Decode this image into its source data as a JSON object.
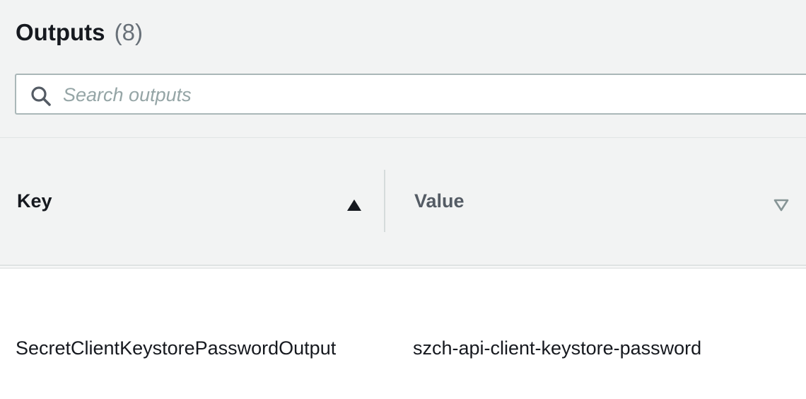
{
  "outputs": {
    "title": "Outputs",
    "count": "(8)",
    "search": {
      "placeholder": "Search outputs",
      "value": ""
    },
    "columns": [
      {
        "label": "Key",
        "sort": "ascending",
        "sort_icon": "sort-ascending-icon"
      },
      {
        "label": "Value",
        "sort": "none",
        "sort_icon": "sort-descending-outline-icon"
      }
    ],
    "rows": [
      {
        "key": "SecretClientKeystorePasswordOutput",
        "value": "szch-api-client-keystore-password"
      }
    ]
  },
  "colors": {
    "header_bg": "#f2f3f3",
    "text_primary": "#16191f",
    "text_secondary": "#545b64",
    "count_text": "#687078",
    "placeholder": "#95a5a6",
    "border": "#aab7b8"
  }
}
